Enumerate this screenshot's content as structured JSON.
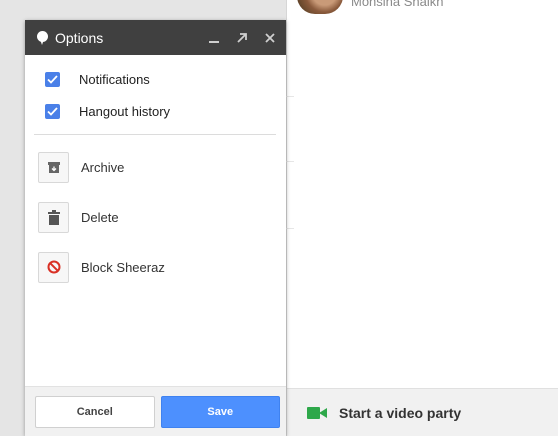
{
  "contact": {
    "name": "Mohsina Shaikh"
  },
  "dialog": {
    "title": "Options",
    "controls": {
      "minimize": "minimize-icon",
      "popout": "popout-arrow-icon",
      "close": "close-icon"
    },
    "checkboxes": [
      {
        "label": "Notifications",
        "checked": true
      },
      {
        "label": "Hangout history",
        "checked": true
      }
    ],
    "actions": [
      {
        "label": "Archive",
        "icon": "archive-icon"
      },
      {
        "label": "Delete",
        "icon": "trash-icon"
      },
      {
        "label": "Block Sheeraz",
        "icon": "block-icon"
      }
    ],
    "footer": {
      "cancel_label": "Cancel",
      "save_label": "Save"
    }
  },
  "right_panel": {
    "video_party_label": "Start a video party"
  },
  "colors": {
    "titlebar": "#404040",
    "checkbox": "#4a80e8",
    "save_button": "#4d90fe",
    "video_icon": "#2ea84a",
    "block_icon": "#d93025"
  }
}
